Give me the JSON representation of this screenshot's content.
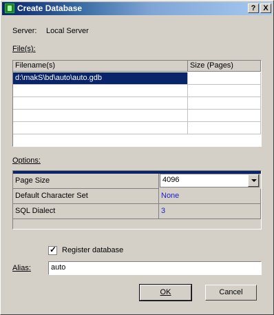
{
  "window": {
    "title": "Create Database",
    "help_btn": "?",
    "close_btn": "X"
  },
  "server": {
    "label": "Server:",
    "value": "Local Server"
  },
  "files": {
    "label": "File(s):",
    "columns": [
      "Filename(s)",
      "Size (Pages)"
    ],
    "rows": [
      {
        "filename": "d:\\makS\\bd\\auto\\auto.gdb",
        "size": ""
      },
      {
        "filename": "",
        "size": ""
      },
      {
        "filename": "",
        "size": ""
      },
      {
        "filename": "",
        "size": ""
      },
      {
        "filename": "",
        "size": ""
      }
    ]
  },
  "options": {
    "label": "Options:",
    "rows": [
      {
        "name": "Page Size",
        "value": "4096"
      },
      {
        "name": "Default Character Set",
        "value": "None"
      },
      {
        "name": "SQL Dialect",
        "value": "3"
      }
    ]
  },
  "register": {
    "label": "Register database",
    "checked": true
  },
  "alias": {
    "label": "Alias:",
    "value": "auto"
  },
  "buttons": {
    "ok": "OK",
    "cancel": "Cancel"
  }
}
